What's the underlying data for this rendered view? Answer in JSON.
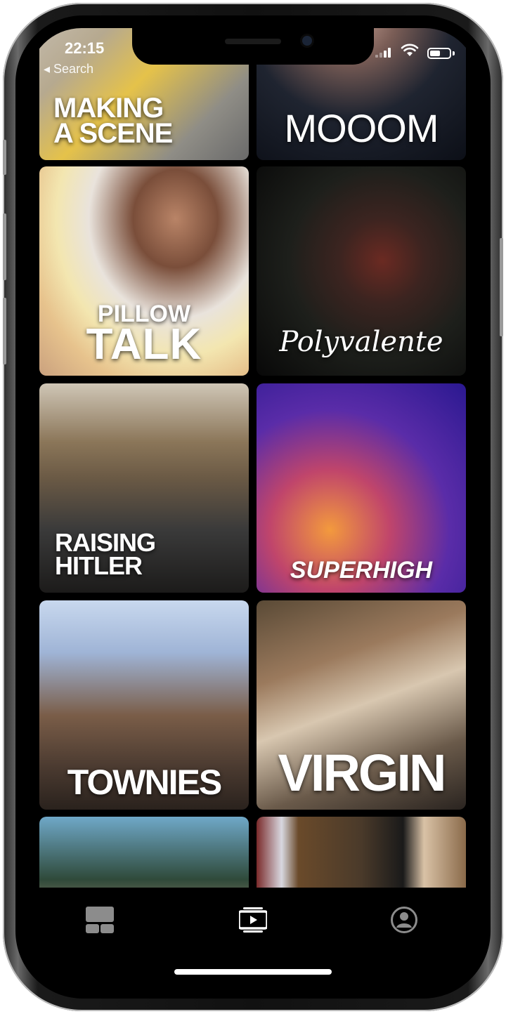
{
  "status_bar": {
    "time": "22:15",
    "back_label": "◂ Search"
  },
  "tiles": [
    {
      "title_lines": [
        "MAKING",
        "A SCENE"
      ]
    },
    {
      "title_lines": [
        "MOOOM"
      ]
    },
    {
      "title_lines": [
        "PILLOW",
        "TALK"
      ]
    },
    {
      "title_lines": [
        "Polyvalente"
      ]
    },
    {
      "title_lines": [
        "RAISING",
        "HITLER"
      ]
    },
    {
      "title_lines": [
        "SUPERHIGH"
      ]
    },
    {
      "title_lines": [
        "TOWNIES"
      ]
    },
    {
      "title_lines": [
        "VIRGIN"
      ]
    }
  ],
  "tabbar": {
    "items": [
      {
        "icon": "grid-icon",
        "active": false
      },
      {
        "icon": "video-icon",
        "active": true
      },
      {
        "icon": "profile-icon",
        "active": false
      }
    ]
  },
  "colors": {
    "background": "#000000",
    "text": "#ffffff",
    "inactive_icon": "#8c8c8c"
  }
}
